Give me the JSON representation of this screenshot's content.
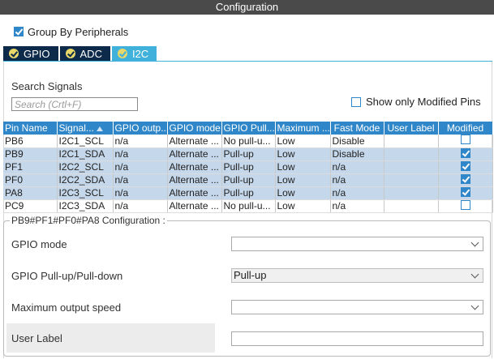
{
  "window": {
    "title": "Configuration"
  },
  "options": {
    "group_by_label": "Group By Peripherals",
    "group_by_checked": true
  },
  "tabs": [
    {
      "label": "GPIO",
      "icon": "check-circle-icon",
      "active": false
    },
    {
      "label": "ADC",
      "icon": "check-circle-icon",
      "active": false
    },
    {
      "label": "I2C",
      "icon": "check-circle-icon",
      "active": true
    }
  ],
  "search": {
    "label": "Search Signals",
    "placeholder": "Search (Crtl+F)",
    "value": ""
  },
  "filter": {
    "only_modified_label": "Show only Modified Pins",
    "checked": false
  },
  "table": {
    "headers": [
      "Pin Name",
      "Signal...",
      "GPIO outp...",
      "GPIO mode",
      "GPIO Pull...",
      "Maximum ...",
      "Fast Mode",
      "User Label",
      "Modified"
    ],
    "sort_column": 1,
    "rows": [
      {
        "cells": [
          "PB6",
          "I2C1_SCL",
          "n/a",
          "Alternate ...",
          "No pull-u...",
          "Low",
          "Disable",
          ""
        ],
        "modified": false,
        "selected": false
      },
      {
        "cells": [
          "PB9",
          "I2C1_SDA",
          "n/a",
          "Alternate ...",
          "Pull-up",
          "Low",
          "Disable",
          ""
        ],
        "modified": true,
        "selected": true
      },
      {
        "cells": [
          "PF1",
          "I2C2_SCL",
          "n/a",
          "Alternate ...",
          "Pull-up",
          "Low",
          "n/a",
          ""
        ],
        "modified": true,
        "selected": true
      },
      {
        "cells": [
          "PF0",
          "I2C2_SDA",
          "n/a",
          "Alternate ...",
          "Pull-up",
          "Low",
          "n/a",
          ""
        ],
        "modified": true,
        "selected": true
      },
      {
        "cells": [
          "PA8",
          "I2C3_SCL",
          "n/a",
          "Alternate ...",
          "Pull-up",
          "Low",
          "n/a",
          ""
        ],
        "modified": true,
        "selected": true
      },
      {
        "cells": [
          "PC9",
          "I2C3_SDA",
          "n/a",
          "Alternate ...",
          "No pull-u...",
          "Low",
          "n/a",
          ""
        ],
        "modified": false,
        "selected": false
      }
    ]
  },
  "config": {
    "title": "PB9#PF1#PF0#PA8 Configuration :",
    "fields": [
      {
        "label": "GPIO mode",
        "value": ""
      },
      {
        "label": "GPIO Pull-up/Pull-down",
        "value": "Pull-up"
      },
      {
        "label": "Maximum output speed",
        "value": ""
      },
      {
        "label": "User Label",
        "value": ""
      }
    ]
  },
  "colors": {
    "accent": "#2f86c8",
    "tab_bg": "#0d2a4a",
    "tab_active": "#3fb1da",
    "selected_row": "#c5d7ea"
  }
}
